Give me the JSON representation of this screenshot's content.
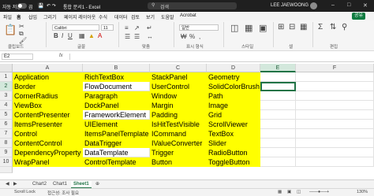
{
  "titlebar": {
    "autosave_label": "자동 저장",
    "autosave_state": "끔",
    "file_name": "통합 문서1 - Excel",
    "search_placeholder": "검색",
    "user_name": "LEE JAEWOONG"
  },
  "menu": {
    "items": [
      "파일",
      "홈",
      "삽입",
      "그리기",
      "페이지 레이아웃",
      "수식",
      "데이터",
      "검토",
      "보기",
      "도움말",
      "Acrobat"
    ],
    "share_label": "공유"
  },
  "ribbon": {
    "font_name": "Calibri",
    "font_size": "11",
    "number_format": "일반",
    "groups": [
      "클립보드",
      "글꼴",
      "맞춤",
      "표시 형식",
      "스타일",
      "셀",
      "편집"
    ]
  },
  "formula_bar": {
    "name_box": "E2",
    "fx_label": "fx",
    "content": ""
  },
  "columns": [
    "A",
    "B",
    "C",
    "D",
    "E",
    "F"
  ],
  "selected_cell": "E2",
  "rows": [
    [
      "1",
      "Application",
      "RichTextBox",
      "StackPanel",
      "Geometry"
    ],
    [
      "2",
      "Border",
      "FlowDocument",
      "UserControl",
      "SolidColorBrush"
    ],
    [
      "3",
      "CornerRadius",
      "Paragraph",
      "Window",
      "Path"
    ],
    [
      "4",
      "ViewBox",
      "DockPanel",
      "Margin",
      "Image"
    ],
    [
      "5",
      "ContentPresenter",
      "FrameworkElement",
      "Padding",
      "Grid"
    ],
    [
      "6",
      "ItemsPresenter",
      "UIElement",
      "IsHitTestVisible",
      "ScrollViewer"
    ],
    [
      "7",
      "Control",
      "ItemsPanelTemplate",
      "ICommand",
      "TextBox"
    ],
    [
      "8",
      "ContentControl",
      "DataTrigger",
      "IValueConverter",
      "Slider"
    ],
    [
      "9",
      "DependencyProperty",
      "DataTemplate",
      "Trigger",
      "RadioButton"
    ],
    [
      "10",
      "WrapPanel",
      "ControlTemplate",
      "Button",
      "ToggleButton"
    ]
  ],
  "sheet_tabs": [
    "Chart2",
    "Chart1",
    "Sheet1"
  ],
  "active_sheet": "Sheet1",
  "status": {
    "mode": "Scroll Lock",
    "accessibility": "접근성: 조사 필요",
    "zoom": "130%"
  },
  "colors": {
    "highlight": "#ffff00",
    "accent": "#217346"
  }
}
